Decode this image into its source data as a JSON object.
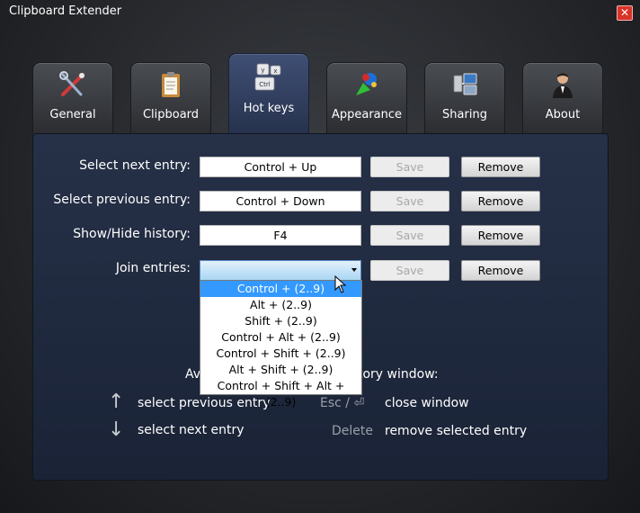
{
  "window": {
    "title": "Clipboard Extender",
    "close_glyph": "✕"
  },
  "tabs": [
    {
      "label": "General",
      "icon": "tools-icon",
      "active": false
    },
    {
      "label": "Clipboard",
      "icon": "clipboard-icon",
      "active": false
    },
    {
      "label": "Hot keys",
      "icon": "keyboard-icon",
      "active": true
    },
    {
      "label": "Appearance",
      "icon": "paint-icon",
      "active": false
    },
    {
      "label": "Sharing",
      "icon": "network-icon",
      "active": false
    },
    {
      "label": "About",
      "icon": "person-icon",
      "active": false
    }
  ],
  "tab_icon_keys": {
    "y": "y",
    "x": "x",
    "ctrl": "Ctrl"
  },
  "hotkeys": [
    {
      "label": "Select next entry:",
      "value": "Control + Up",
      "save": "Save",
      "remove": "Remove"
    },
    {
      "label": "Select previous entry:",
      "value": "Control + Down",
      "save": "Save",
      "remove": "Remove"
    },
    {
      "label": "Show/Hide history:",
      "value": "F4",
      "save": "Save",
      "remove": "Remove"
    },
    {
      "label": "Join entries:",
      "value": "",
      "save": "Save",
      "remove": "Remove"
    }
  ],
  "join_dropdown": {
    "options": [
      "Control + (2..9)",
      "Alt + (2..9)",
      "Shift + (2..9)",
      "Control + Alt + (2..9)",
      "Control + Shift + (2..9)",
      "Alt + Shift + (2..9)",
      "Control + Shift + Alt + (2..9)"
    ],
    "highlighted_index": 0
  },
  "info": {
    "title_left": "Av",
    "title_right": "tory window:",
    "items": [
      {
        "key_glyph": "↑",
        "desc": "select previous entry"
      },
      {
        "key_glyph": "↓",
        "desc": "select next entry"
      },
      {
        "key_name": "Esc / ⏎",
        "desc": "close window"
      },
      {
        "key_name": "Delete",
        "desc": "remove selected entry"
      }
    ]
  }
}
